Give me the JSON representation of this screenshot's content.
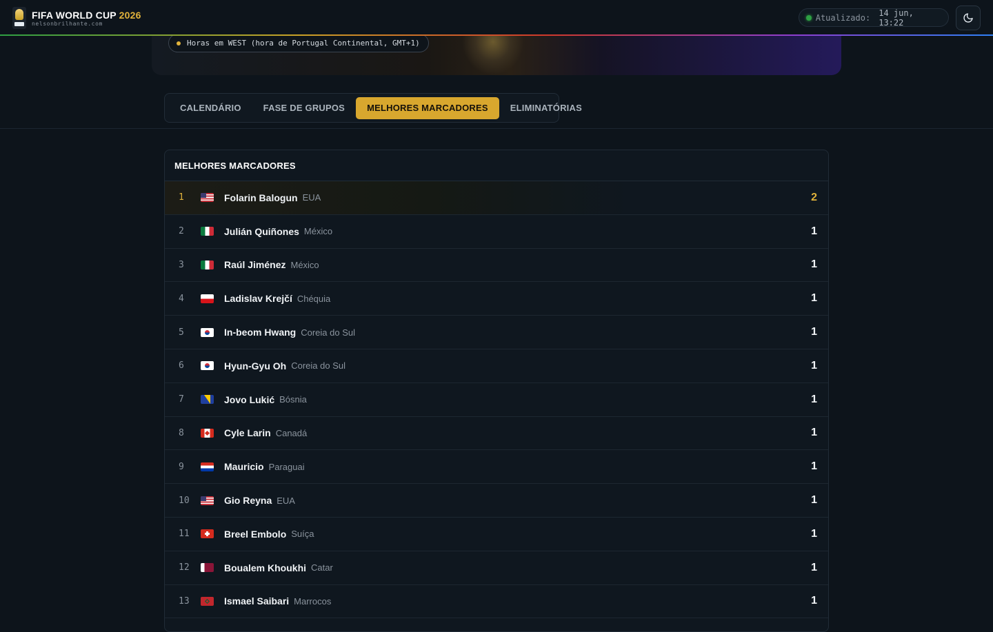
{
  "header": {
    "brand_title": "FIFA WORLD CUP",
    "brand_year": "2026",
    "brand_site": "nelsonbrilhante.com",
    "updated_label": "Atualizado:",
    "updated_value": "14 jun, 13:22",
    "theme_icon": "moon-icon",
    "accent_color": "#d8a72e",
    "status_color": "#2ea043"
  },
  "timezone_notice": "Horas em WEST (hora de Portugal Continental, GMT+1)",
  "tabs": [
    {
      "label": "CALENDÁRIO"
    },
    {
      "label": "FASE DE GRUPOS"
    },
    {
      "label": "MELHORES MARCADORES",
      "active": true
    },
    {
      "label": "ELIMINATÓRIAS"
    }
  ],
  "scorers": {
    "title": "MELHORES MARCADORES",
    "rows": [
      {
        "rank": "1",
        "flag": "us",
        "name": "Folarin Balogun",
        "team": "EUA",
        "goals": "2"
      },
      {
        "rank": "2",
        "flag": "mx",
        "name": "Julián Quiñones",
        "team": "México",
        "goals": "1"
      },
      {
        "rank": "3",
        "flag": "mx",
        "name": "Raúl Jiménez",
        "team": "México",
        "goals": "1"
      },
      {
        "rank": "4",
        "flag": "cz",
        "name": "Ladislav Krejčí",
        "team": "Chéquia",
        "goals": "1"
      },
      {
        "rank": "5",
        "flag": "kr",
        "name": "In-beom Hwang",
        "team": "Coreia do Sul",
        "goals": "1"
      },
      {
        "rank": "6",
        "flag": "kr",
        "name": "Hyun-Gyu Oh",
        "team": "Coreia do Sul",
        "goals": "1"
      },
      {
        "rank": "7",
        "flag": "ba",
        "name": "Jovo Lukić",
        "team": "Bósnia",
        "goals": "1"
      },
      {
        "rank": "8",
        "flag": "ca",
        "name": "Cyle Larin",
        "team": "Canadá",
        "goals": "1"
      },
      {
        "rank": "9",
        "flag": "py",
        "name": "Mauricio",
        "team": "Paraguai",
        "goals": "1"
      },
      {
        "rank": "10",
        "flag": "us",
        "name": "Gio Reyna",
        "team": "EUA",
        "goals": "1"
      },
      {
        "rank": "11",
        "flag": "ch",
        "name": "Breel Embolo",
        "team": "Suíça",
        "goals": "1"
      },
      {
        "rank": "12",
        "flag": "qa",
        "name": "Boualem Khoukhi",
        "team": "Catar",
        "goals": "1"
      },
      {
        "rank": "13",
        "flag": "ma",
        "name": "Ismael Saibari",
        "team": "Marrocos",
        "goals": "1"
      }
    ]
  }
}
